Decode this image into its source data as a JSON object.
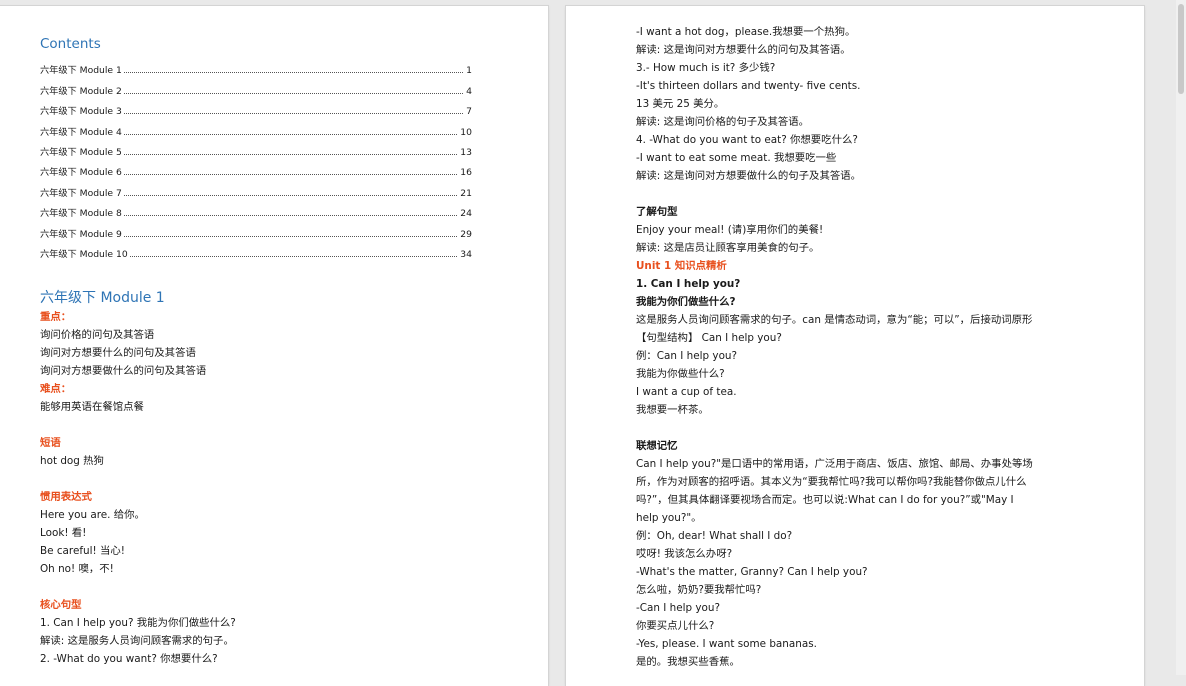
{
  "left_page": {
    "toc_title": "Contents",
    "toc": [
      {
        "label": "六年级下 Module 1",
        "page": "1"
      },
      {
        "label": "六年级下 Module 2",
        "page": "4"
      },
      {
        "label": "六年级下 Module 3",
        "page": "7"
      },
      {
        "label": "六年级下 Module 4",
        "page": "10"
      },
      {
        "label": "六年级下 Module 5",
        "page": "13"
      },
      {
        "label": "六年级下 Module 6",
        "page": "16"
      },
      {
        "label": "六年级下 Module 7",
        "page": "21"
      },
      {
        "label": "六年级下 Module 8",
        "page": "24"
      },
      {
        "label": "六年级下 Module 9",
        "page": "29"
      },
      {
        "label": "六年级下 Module 10",
        "page": "34"
      }
    ],
    "heading": "六年级下 Module 1",
    "lines": [
      {
        "text": "重点：",
        "style": "orange"
      },
      {
        "text": "询问价格的问句及其答语",
        "style": "normal"
      },
      {
        "text": "询问对方想要什么的问句及其答语",
        "style": "normal"
      },
      {
        "text": "询问对方想要做什么的问句及其答语",
        "style": "normal"
      },
      {
        "text": "难点：",
        "style": "orange"
      },
      {
        "text": "能够用英语在餐馆点餐",
        "style": "normal"
      },
      {
        "text": "",
        "style": "gap"
      },
      {
        "text": "短语",
        "style": "orange"
      },
      {
        "text": "hot dog 热狗",
        "style": "normal"
      },
      {
        "text": "",
        "style": "gap"
      },
      {
        "text": "惯用表达式",
        "style": "orange"
      },
      {
        "text": "Here you are. 给你。",
        "style": "normal"
      },
      {
        "text": "Look! 看!",
        "style": "normal"
      },
      {
        "text": "Be careful! 当心!",
        "style": "normal"
      },
      {
        "text": "Oh no! 噢，不!",
        "style": "normal"
      },
      {
        "text": "",
        "style": "gap"
      },
      {
        "text": "核心句型",
        "style": "orange"
      },
      {
        "text": " 1. Can I help you? 我能为你们做些什么?",
        "style": "normal"
      },
      {
        "text": "解读: 这是服务人员询问顾客需求的句子。",
        "style": "normal"
      },
      {
        "text": "2. -What do you want? 你想要什么?",
        "style": "normal"
      }
    ]
  },
  "right_page": {
    "lines": [
      {
        "text": "-I want a hot dog，please.我想要一个热狗。",
        "style": "normal"
      },
      {
        "text": "解读: 这是询问对方想要什么的问句及其答语。",
        "style": "normal"
      },
      {
        "text": "3.- How much is it? 多少钱?",
        "style": "normal"
      },
      {
        "text": "-It's thirteen dollars and twenty- five cents.",
        "style": "normal"
      },
      {
        "text": "13 美元 25 美分。",
        "style": "normal"
      },
      {
        "text": "解读: 这是询问价格的句子及其答语。",
        "style": "normal"
      },
      {
        "text": "4. -What do you want to eat? 你想要吃什么?",
        "style": "normal"
      },
      {
        "text": "-I want to eat some meat. 我想要吃一些",
        "style": "normal"
      },
      {
        "text": "解读: 这是询问对方想要做什么的句子及其答语。",
        "style": "normal"
      },
      {
        "text": "",
        "style": "gap"
      },
      {
        "text": "了解句型",
        "style": "bold"
      },
      {
        "text": "Enjoy your meal! (请)享用你们的美餐!",
        "style": "normal"
      },
      {
        "text": "解读: 这是店员让顾客享用美食的句子。",
        "style": "normal"
      },
      {
        "text": "Unit 1 知识点精析",
        "style": "orange"
      },
      {
        "text": "1. Can I help you?",
        "style": "bold"
      },
      {
        "text": "我能为你们做些什么?",
        "style": "bold"
      },
      {
        "text": "这是服务人员询问顾客需求的句子。can 是情态动词，意为“能；可以”，后接动词原形",
        "style": "normal"
      },
      {
        "text": "【句型结构】 Can I help you?",
        "style": "normal"
      },
      {
        "text": "例：Can I help you?",
        "style": "normal"
      },
      {
        "text": "我能为你做些什么?",
        "style": "normal"
      },
      {
        "text": "I want a cup of tea.",
        "style": "normal"
      },
      {
        "text": "我想要一杯茶。",
        "style": "normal"
      },
      {
        "text": "",
        "style": "gap"
      },
      {
        "text": "联想记忆",
        "style": "bold"
      },
      {
        "text": "Can I help you?\"是口语中的常用语，广泛用于商店、饭店、旅馆、邮局、办事处等场",
        "style": "normal"
      },
      {
        "text": "所，作为对顾客的招呼语。其本义为“要我帮忙吗?我可以帮你吗?我能替你做点儿什么",
        "style": "normal"
      },
      {
        "text": "吗?”，但其具体翻译要视场合而定。也可以说:What can I do for you?”或\"May I",
        "style": "normal"
      },
      {
        "text": "help you?\"。",
        "style": "normal"
      },
      {
        "text": "例：Oh, dear! What shall I do?",
        "style": "normal"
      },
      {
        "text": "哎呀! 我该怎么办呀?",
        "style": "normal"
      },
      {
        "text": "-What's the matter, Granny? Can I help you?",
        "style": "normal"
      },
      {
        "text": "怎么啦，奶奶?要我帮忙吗?",
        "style": "normal"
      },
      {
        "text": "-Can I help you?",
        "style": "normal"
      },
      {
        "text": "你要买点儿什么?",
        "style": "normal"
      },
      {
        "text": "-Yes, please. I want some bananas.",
        "style": "normal"
      },
      {
        "text": "是的。我想买些香蕉。",
        "style": "normal"
      }
    ]
  }
}
